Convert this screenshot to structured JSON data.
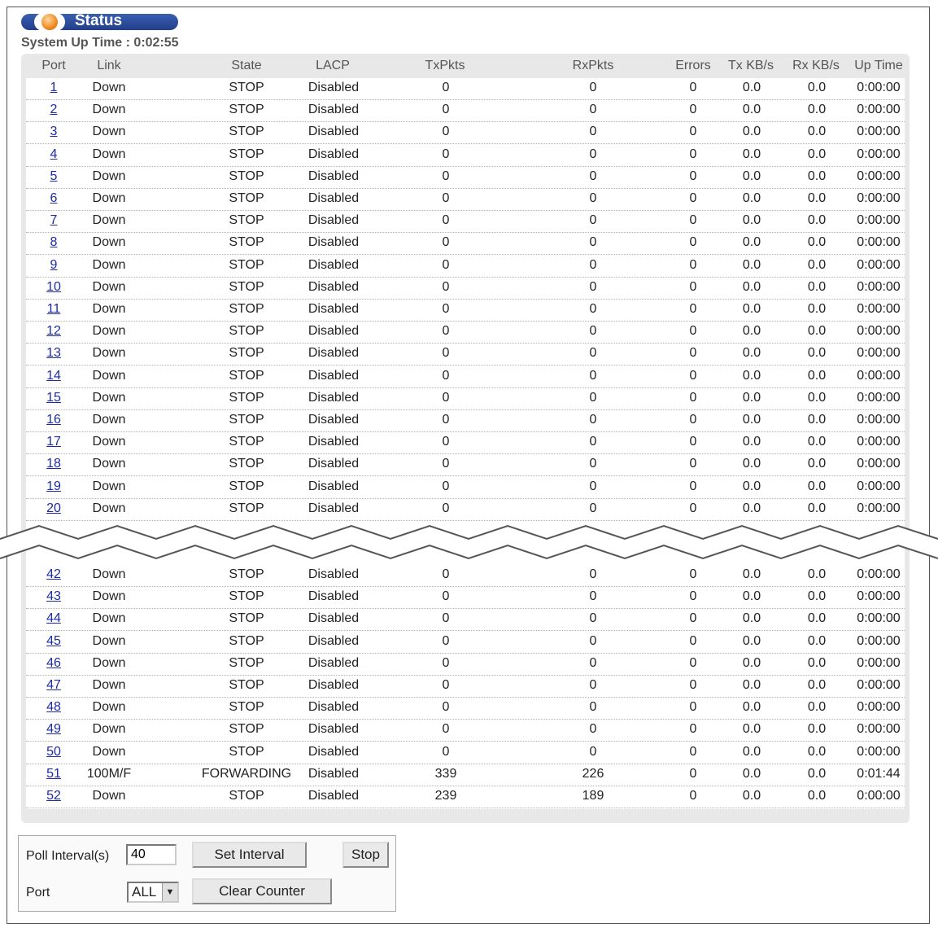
{
  "title": "Status",
  "uptime_label": "System Up Time : 0:02:55",
  "columns": [
    "Port",
    "Link",
    "State",
    "LACP",
    "TxPkts",
    "RxPkts",
    "Errors",
    "Tx KB/s",
    "Rx KB/s",
    "Up Time"
  ],
  "rows_top": [
    {
      "port": "1",
      "link": "Down",
      "state": "STOP",
      "lacp": "Disabled",
      "tx": "0",
      "rx": "0",
      "err": "0",
      "txkb": "0.0",
      "rxkb": "0.0",
      "up": "0:00:00"
    },
    {
      "port": "2",
      "link": "Down",
      "state": "STOP",
      "lacp": "Disabled",
      "tx": "0",
      "rx": "0",
      "err": "0",
      "txkb": "0.0",
      "rxkb": "0.0",
      "up": "0:00:00"
    },
    {
      "port": "3",
      "link": "Down",
      "state": "STOP",
      "lacp": "Disabled",
      "tx": "0",
      "rx": "0",
      "err": "0",
      "txkb": "0.0",
      "rxkb": "0.0",
      "up": "0:00:00"
    },
    {
      "port": "4",
      "link": "Down",
      "state": "STOP",
      "lacp": "Disabled",
      "tx": "0",
      "rx": "0",
      "err": "0",
      "txkb": "0.0",
      "rxkb": "0.0",
      "up": "0:00:00"
    },
    {
      "port": "5",
      "link": "Down",
      "state": "STOP",
      "lacp": "Disabled",
      "tx": "0",
      "rx": "0",
      "err": "0",
      "txkb": "0.0",
      "rxkb": "0.0",
      "up": "0:00:00"
    },
    {
      "port": "6",
      "link": "Down",
      "state": "STOP",
      "lacp": "Disabled",
      "tx": "0",
      "rx": "0",
      "err": "0",
      "txkb": "0.0",
      "rxkb": "0.0",
      "up": "0:00:00"
    },
    {
      "port": "7",
      "link": "Down",
      "state": "STOP",
      "lacp": "Disabled",
      "tx": "0",
      "rx": "0",
      "err": "0",
      "txkb": "0.0",
      "rxkb": "0.0",
      "up": "0:00:00"
    },
    {
      "port": "8",
      "link": "Down",
      "state": "STOP",
      "lacp": "Disabled",
      "tx": "0",
      "rx": "0",
      "err": "0",
      "txkb": "0.0",
      "rxkb": "0.0",
      "up": "0:00:00"
    },
    {
      "port": "9",
      "link": "Down",
      "state": "STOP",
      "lacp": "Disabled",
      "tx": "0",
      "rx": "0",
      "err": "0",
      "txkb": "0.0",
      "rxkb": "0.0",
      "up": "0:00:00"
    },
    {
      "port": "10",
      "link": "Down",
      "state": "STOP",
      "lacp": "Disabled",
      "tx": "0",
      "rx": "0",
      "err": "0",
      "txkb": "0.0",
      "rxkb": "0.0",
      "up": "0:00:00"
    },
    {
      "port": "11",
      "link": "Down",
      "state": "STOP",
      "lacp": "Disabled",
      "tx": "0",
      "rx": "0",
      "err": "0",
      "txkb": "0.0",
      "rxkb": "0.0",
      "up": "0:00:00"
    },
    {
      "port": "12",
      "link": "Down",
      "state": "STOP",
      "lacp": "Disabled",
      "tx": "0",
      "rx": "0",
      "err": "0",
      "txkb": "0.0",
      "rxkb": "0.0",
      "up": "0:00:00"
    },
    {
      "port": "13",
      "link": "Down",
      "state": "STOP",
      "lacp": "Disabled",
      "tx": "0",
      "rx": "0",
      "err": "0",
      "txkb": "0.0",
      "rxkb": "0.0",
      "up": "0:00:00"
    },
    {
      "port": "14",
      "link": "Down",
      "state": "STOP",
      "lacp": "Disabled",
      "tx": "0",
      "rx": "0",
      "err": "0",
      "txkb": "0.0",
      "rxkb": "0.0",
      "up": "0:00:00"
    },
    {
      "port": "15",
      "link": "Down",
      "state": "STOP",
      "lacp": "Disabled",
      "tx": "0",
      "rx": "0",
      "err": "0",
      "txkb": "0.0",
      "rxkb": "0.0",
      "up": "0:00:00"
    },
    {
      "port": "16",
      "link": "Down",
      "state": "STOP",
      "lacp": "Disabled",
      "tx": "0",
      "rx": "0",
      "err": "0",
      "txkb": "0.0",
      "rxkb": "0.0",
      "up": "0:00:00"
    },
    {
      "port": "17",
      "link": "Down",
      "state": "STOP",
      "lacp": "Disabled",
      "tx": "0",
      "rx": "0",
      "err": "0",
      "txkb": "0.0",
      "rxkb": "0.0",
      "up": "0:00:00"
    },
    {
      "port": "18",
      "link": "Down",
      "state": "STOP",
      "lacp": "Disabled",
      "tx": "0",
      "rx": "0",
      "err": "0",
      "txkb": "0.0",
      "rxkb": "0.0",
      "up": "0:00:00"
    },
    {
      "port": "19",
      "link": "Down",
      "state": "STOP",
      "lacp": "Disabled",
      "tx": "0",
      "rx": "0",
      "err": "0",
      "txkb": "0.0",
      "rxkb": "0.0",
      "up": "0:00:00"
    },
    {
      "port": "20",
      "link": "Down",
      "state": "STOP",
      "lacp": "Disabled",
      "tx": "0",
      "rx": "0",
      "err": "0",
      "txkb": "0.0",
      "rxkb": "0.0",
      "up": "0:00:00"
    }
  ],
  "rows_bottom": [
    {
      "port": "42",
      "link": "Down",
      "state": "STOP",
      "lacp": "Disabled",
      "tx": "0",
      "rx": "0",
      "err": "0",
      "txkb": "0.0",
      "rxkb": "0.0",
      "up": "0:00:00"
    },
    {
      "port": "43",
      "link": "Down",
      "state": "STOP",
      "lacp": "Disabled",
      "tx": "0",
      "rx": "0",
      "err": "0",
      "txkb": "0.0",
      "rxkb": "0.0",
      "up": "0:00:00"
    },
    {
      "port": "44",
      "link": "Down",
      "state": "STOP",
      "lacp": "Disabled",
      "tx": "0",
      "rx": "0",
      "err": "0",
      "txkb": "0.0",
      "rxkb": "0.0",
      "up": "0:00:00"
    },
    {
      "port": "45",
      "link": "Down",
      "state": "STOP",
      "lacp": "Disabled",
      "tx": "0",
      "rx": "0",
      "err": "0",
      "txkb": "0.0",
      "rxkb": "0.0",
      "up": "0:00:00"
    },
    {
      "port": "46",
      "link": "Down",
      "state": "STOP",
      "lacp": "Disabled",
      "tx": "0",
      "rx": "0",
      "err": "0",
      "txkb": "0.0",
      "rxkb": "0.0",
      "up": "0:00:00"
    },
    {
      "port": "47",
      "link": "Down",
      "state": "STOP",
      "lacp": "Disabled",
      "tx": "0",
      "rx": "0",
      "err": "0",
      "txkb": "0.0",
      "rxkb": "0.0",
      "up": "0:00:00"
    },
    {
      "port": "48",
      "link": "Down",
      "state": "STOP",
      "lacp": "Disabled",
      "tx": "0",
      "rx": "0",
      "err": "0",
      "txkb": "0.0",
      "rxkb": "0.0",
      "up": "0:00:00"
    },
    {
      "port": "49",
      "link": "Down",
      "state": "STOP",
      "lacp": "Disabled",
      "tx": "0",
      "rx": "0",
      "err": "0",
      "txkb": "0.0",
      "rxkb": "0.0",
      "up": "0:00:00"
    },
    {
      "port": "50",
      "link": "Down",
      "state": "STOP",
      "lacp": "Disabled",
      "tx": "0",
      "rx": "0",
      "err": "0",
      "txkb": "0.0",
      "rxkb": "0.0",
      "up": "0:00:00"
    },
    {
      "port": "51",
      "link": "100M/F",
      "state": "FORWARDING",
      "lacp": "Disabled",
      "tx": "339",
      "rx": "226",
      "err": "0",
      "txkb": "0.0",
      "rxkb": "0.0",
      "up": "0:01:44"
    },
    {
      "port": "52",
      "link": "Down",
      "state": "STOP",
      "lacp": "Disabled",
      "tx": "239",
      "rx": "189",
      "err": "0",
      "txkb": "0.0",
      "rxkb": "0.0",
      "up": "0:00:00"
    }
  ],
  "controls": {
    "poll_label": "Poll Interval(s)",
    "poll_value": "40",
    "set_interval": "Set Interval",
    "stop": "Stop",
    "port_label": "Port",
    "port_value": "ALL",
    "clear_counter": "Clear Counter"
  },
  "colors": {
    "title_pill": "#2c4a9a",
    "link": "#1c2aa8",
    "header_bg": "#e8e8e8"
  }
}
